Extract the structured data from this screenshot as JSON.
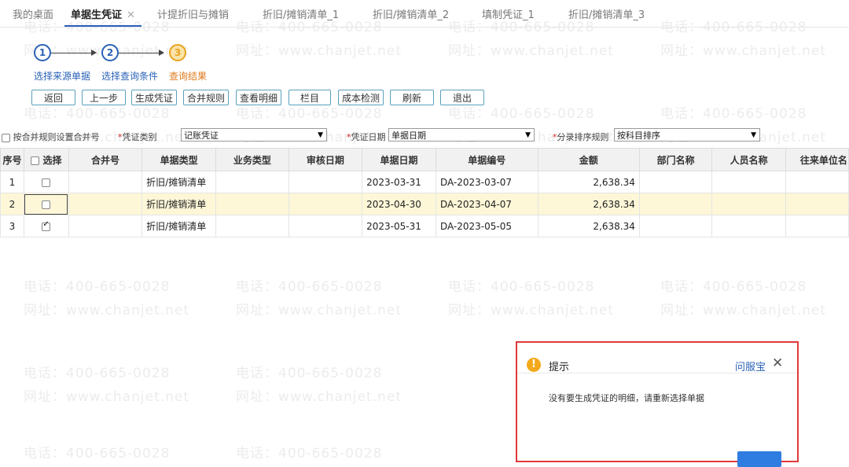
{
  "tabs": [
    {
      "label": "我的桌面"
    },
    {
      "label": "单据生凭证"
    },
    {
      "label": "计提折旧与摊销"
    },
    {
      "label": "折旧/摊销清单_1"
    },
    {
      "label": "折旧/摊销清单_2"
    },
    {
      "label": "填制凭证_1"
    },
    {
      "label": "折旧/摊销清单_3"
    }
  ],
  "active_tab_close": "✕",
  "steps": [
    {
      "number": "1",
      "label": "选择来源单据"
    },
    {
      "number": "2",
      "label": "选择查询条件"
    },
    {
      "number": "3",
      "label": "查询结果"
    }
  ],
  "toolbar": {
    "back": "返回",
    "prev": "上一步",
    "generate": "生成凭证",
    "merge_rule": "合并规则",
    "view_detail": "查看明细",
    "columns": "栏目",
    "cost_check": "成本检测",
    "refresh": "刷新",
    "exit": "退出"
  },
  "filters": {
    "merge_checkbox_label": "按合并规则设置合并号",
    "voucher_type_label": "凭证类别",
    "voucher_type_value": "记账凭证",
    "voucher_date_label": "凭证日期",
    "voucher_date_value": "单据日期",
    "sort_rule_label": "分录排序规则",
    "sort_rule_value": "按科目排序",
    "required_mark": "*"
  },
  "table": {
    "headers": {
      "seq": "序号",
      "select": "选择",
      "merge_no": "合并号",
      "doc_type": "单据类型",
      "biz_type": "业务类型",
      "audit_date": "审核日期",
      "doc_date": "单据日期",
      "doc_no": "单据编号",
      "amount": "金额",
      "dept": "部门名称",
      "person": "人员名称",
      "partner": "往来单位名"
    },
    "rows": [
      {
        "seq": "1",
        "checked": false,
        "merge_no": "",
        "doc_type": "折旧/摊销清单",
        "biz_type": "",
        "audit_date": "",
        "doc_date": "2023-03-31",
        "doc_no": "DA-2023-03-07",
        "amount": "2,638.34",
        "dept": "",
        "person": "",
        "partner": ""
      },
      {
        "seq": "2",
        "checked": false,
        "merge_no": "",
        "doc_type": "折旧/摊销清单",
        "biz_type": "",
        "audit_date": "",
        "doc_date": "2023-04-30",
        "doc_no": "DA-2023-04-07",
        "amount": "2,638.34",
        "dept": "",
        "person": "",
        "partner": ""
      },
      {
        "seq": "3",
        "checked": true,
        "merge_no": "",
        "doc_type": "折旧/摊销清单",
        "biz_type": "",
        "audit_date": "",
        "doc_date": "2023-05-31",
        "doc_no": "DA-2023-05-05",
        "amount": "2,638.34",
        "dept": "",
        "person": "",
        "partner": ""
      }
    ]
  },
  "watermark": {
    "phone": "电话：400-665-0028",
    "site": "网址：www.chanjet.net"
  },
  "dialog": {
    "title": "提示",
    "help_link": "问服宝",
    "close_glyph": "✕",
    "icon_glyph": "!",
    "message": "没有要生成凭证的明细，请重新选择单据"
  },
  "colors": {
    "accent_blue": "#2a62b5",
    "step_current": "#e8a21e",
    "button_border": "#5aa0bd",
    "row_highlight": "#fdf7d8",
    "dialog_border": "#e0393b",
    "warning": "#f3a91c"
  }
}
